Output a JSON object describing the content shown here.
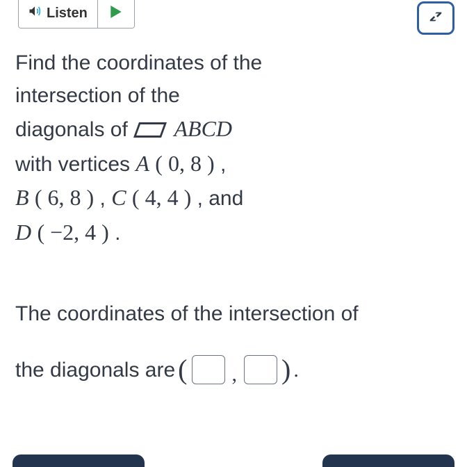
{
  "toolbar": {
    "listen_label": "Listen"
  },
  "question": {
    "line1": "Find the coordinates of the",
    "line2": "intersection of the",
    "line3_prefix": "diagonals of ",
    "shape_label": "ABCD",
    "line4_prefix": "with vertices ",
    "A_label": "A",
    "A_coords": "( 0, 8 )",
    "sep": " , ",
    "B_label": "B",
    "B_coords": "( 6, 8 )",
    "C_label": "C",
    "C_coords": "( 4, 4 )",
    "and_word": " , and",
    "D_label": "D",
    "D_coords": "( −2, 4 )",
    "final_period": " ."
  },
  "answer": {
    "line1": "The coordinates of the intersection of",
    "line2_prefix": "the diagonals are ",
    "open_paren": "(",
    "comma": ",",
    "close_paren": ")",
    "period": "."
  }
}
